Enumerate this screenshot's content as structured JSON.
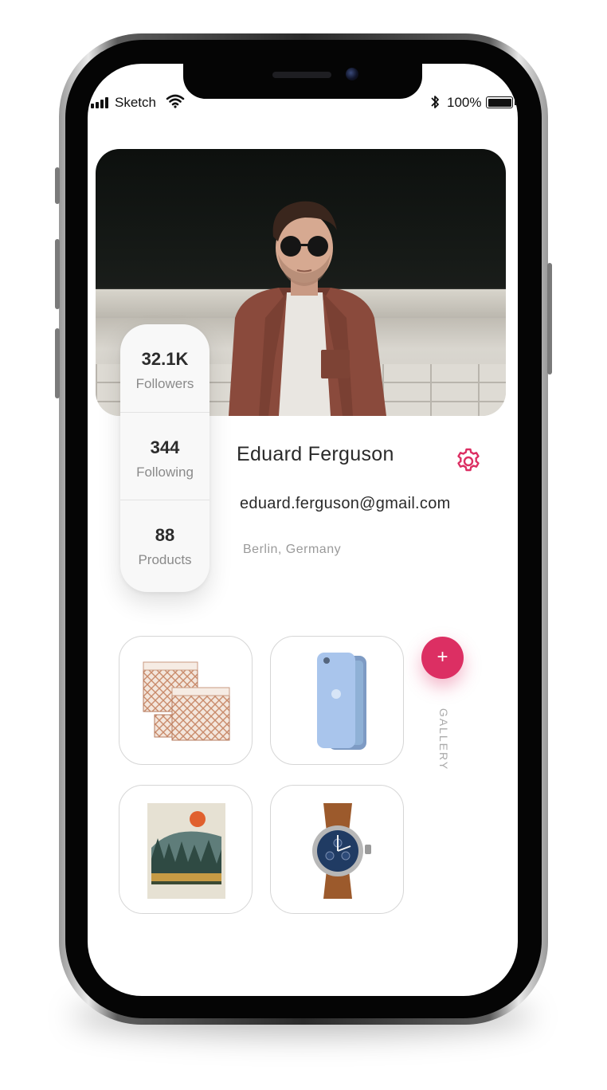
{
  "status_bar": {
    "carrier": "Sketch",
    "battery_percent": "100%",
    "signal_icon": "signal-icon",
    "wifi_icon": "wifi-icon",
    "bluetooth_icon": "bluetooth-icon",
    "battery_icon": "battery-icon",
    "battery_level": 1.0
  },
  "profile": {
    "cover_image": "portrait-photo",
    "name": "Eduard Ferguson",
    "email": "eduard.ferguson@gmail.com",
    "location": "Berlin, Germany",
    "settings_icon": "gear-icon"
  },
  "stats": [
    {
      "value": "32.1K",
      "label": "Followers"
    },
    {
      "value": "344",
      "label": "Following"
    },
    {
      "value": "88",
      "label": "Products"
    }
  ],
  "gallery": {
    "label": "GALLERY",
    "add_label": "+",
    "items": [
      {
        "image": "storage-boxes-image"
      },
      {
        "image": "phone-case-image"
      },
      {
        "image": "forest-painting-image"
      },
      {
        "image": "wristwatch-image"
      }
    ]
  },
  "colors": {
    "accent": "#dc2f63",
    "text_primary": "#2a2a2a",
    "text_secondary": "#9a9a9a"
  }
}
